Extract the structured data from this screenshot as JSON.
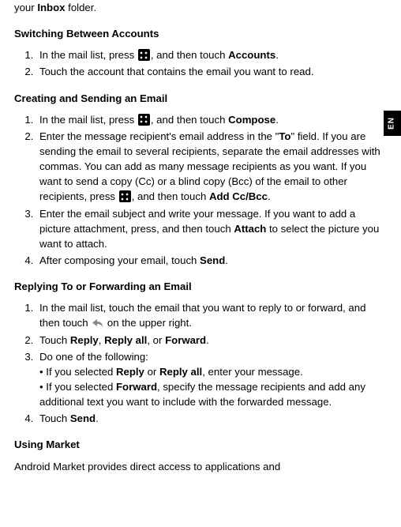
{
  "sideTab": "EN",
  "intro_pre": "your ",
  "intro_bold": "Inbox",
  "intro_post": " folder.",
  "sections": {
    "switching": {
      "heading": "Switching Between Accounts",
      "s1_a": "In the mail list, press ",
      "s1_b": ", and then touch ",
      "s1_bold": "Accounts",
      "s1_c": ".",
      "s2": "Touch the account that contains the email you want to read."
    },
    "creating": {
      "heading": "Creating and Sending an Email",
      "s1_a": "In the mail list, press ",
      "s1_b": ", and then touch ",
      "s1_bold": "Compose",
      "s1_c": ".",
      "s2_a": "Enter the message recipient's email address in the \"",
      "s2_bold1": "To",
      "s2_b": "\" field. If you are sending the email to several recipients, separate the email addresses with commas. You can add as many message recipients as you want. If you want to send a copy (Cc) or a blind copy (Bcc) of the email to other recipients, press ",
      "s2_c": ", and then touch ",
      "s2_bold2": "Add Cc/Bcc",
      "s2_d": ".",
      "s3_a": "Enter the email subject and write your message. If you want to add a picture attachment, press, and then touch ",
      "s3_bold": "Attach",
      "s3_b": " to select the picture you want to attach.",
      "s4_a": "After composing your email, touch ",
      "s4_bold": "Send",
      "s4_b": "."
    },
    "replying": {
      "heading": "Replying To or Forwarding an Email",
      "s1_a": "In the mail list, touch the email that you want to reply to or forward, and then touch ",
      "s1_b": " on the upper right.",
      "s2_a": "Touch ",
      "s2_bold1": "Reply",
      "s2_b": ", ",
      "s2_bold2": "Reply all",
      "s2_c": ", or ",
      "s2_bold3": "Forward",
      "s2_d": ".",
      "s3": "Do one of the following:",
      "s3_b1_a": "• If you selected ",
      "s3_b1_bold1": "Reply",
      "s3_b1_b": " or ",
      "s3_b1_bold2": "Reply all",
      "s3_b1_c": ", enter your message.",
      "s3_b2_a": "• If you selected ",
      "s3_b2_bold": "Forward",
      "s3_b2_b": ", specify the message recipients and add any additional text you want to include with the forwarded message.",
      "s4_a": "Touch ",
      "s4_bold": "Send",
      "s4_b": "."
    },
    "market": {
      "heading": "Using Market",
      "body": "Android Market provides direct access to applications and"
    }
  }
}
